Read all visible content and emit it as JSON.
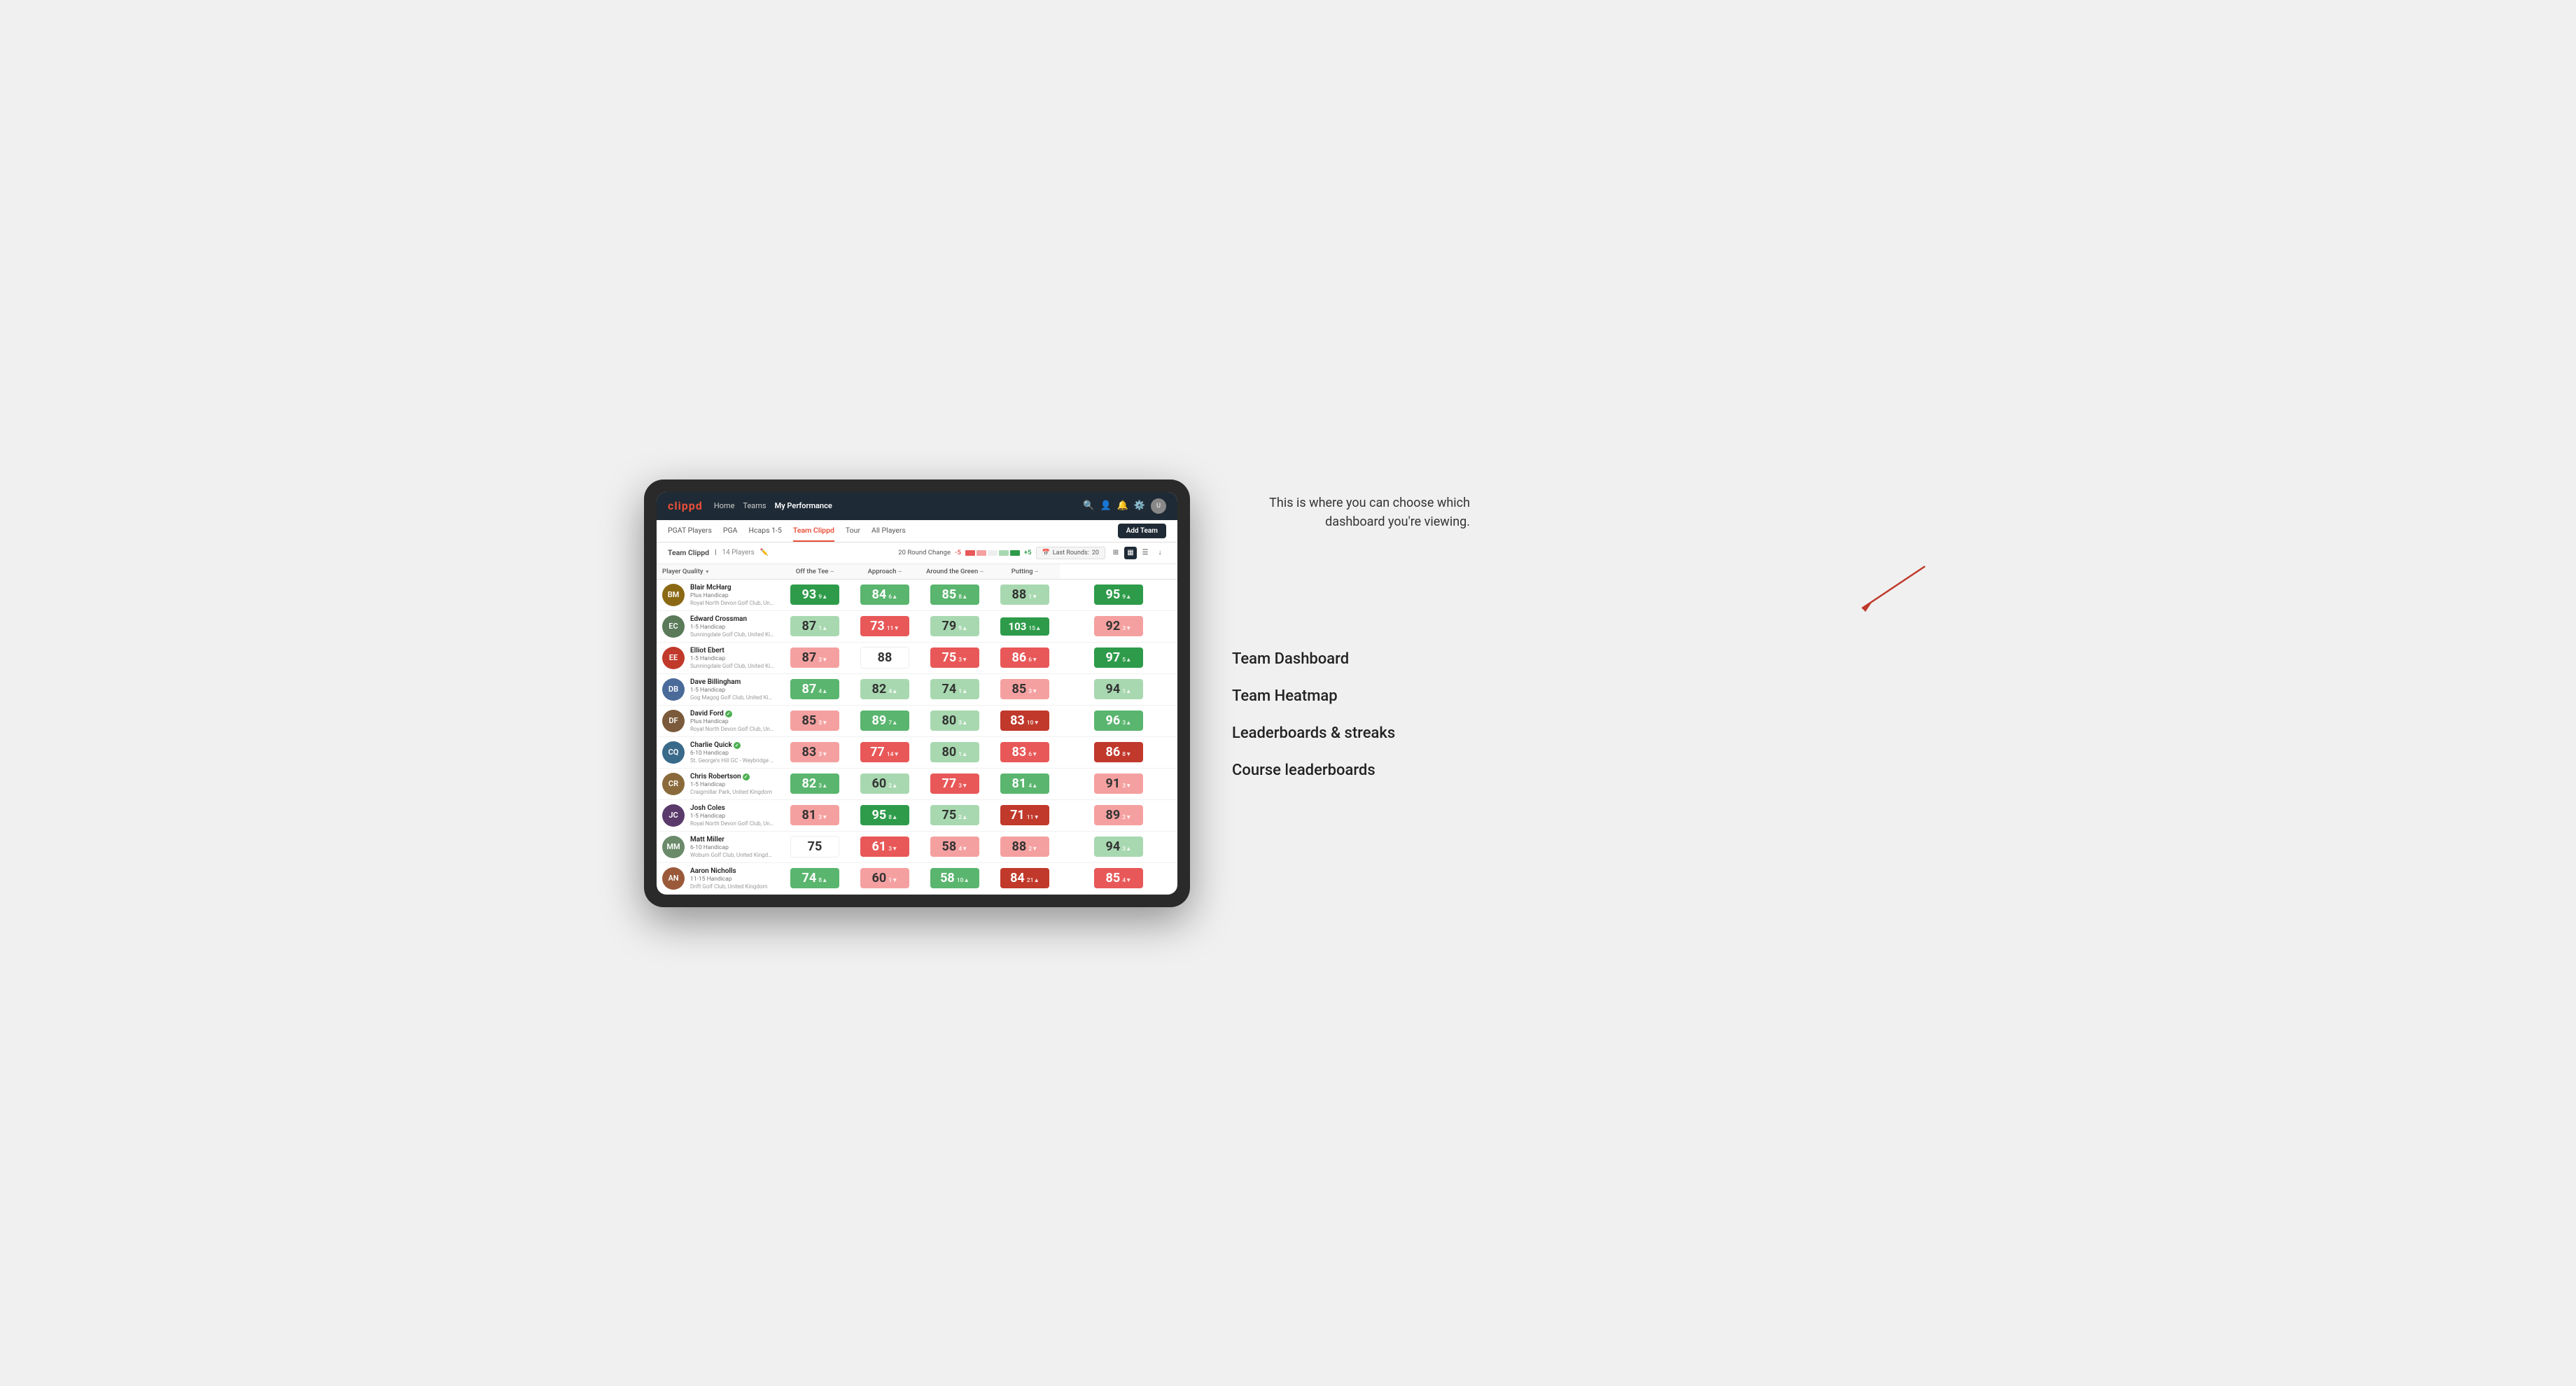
{
  "annotation": {
    "intro": "This is where you can choose which dashboard you're viewing.",
    "items": [
      "Team Dashboard",
      "Team Heatmap",
      "Leaderboards & streaks",
      "Course leaderboards"
    ]
  },
  "nav": {
    "logo": "clippd",
    "links": [
      "Home",
      "Teams",
      "My Performance"
    ],
    "active_link": "My Performance"
  },
  "sub_nav": {
    "links": [
      "PGAT Players",
      "PGA",
      "Hcaps 1-5",
      "Team Clippd",
      "Tour",
      "All Players"
    ],
    "active": "Team Clippd",
    "add_team": "Add Team"
  },
  "team_header": {
    "name": "Team Clippd",
    "separator": "|",
    "count": "14 Players",
    "round_change_label": "20 Round Change",
    "change_value": "-5",
    "change_positive": "+5",
    "last_rounds_label": "Last Rounds:",
    "last_rounds_value": "20"
  },
  "columns": {
    "player": "Player Quality",
    "off_tee": "Off the Tee",
    "approach": "Approach",
    "around_green": "Around the Green",
    "putting": "Putting"
  },
  "players": [
    {
      "name": "Blair McHarg",
      "handicap": "Plus Handicap",
      "club": "Royal North Devon Golf Club, United Kingdom",
      "avatar_color": "#8B6914",
      "initials": "BM",
      "player_quality": {
        "value": "93",
        "change": "9",
        "direction": "up",
        "bg": "bg-green-dark"
      },
      "off_tee": {
        "value": "84",
        "change": "6",
        "direction": "up",
        "bg": "bg-green-mid"
      },
      "approach": {
        "value": "85",
        "change": "8",
        "direction": "up",
        "bg": "bg-green-mid"
      },
      "around_green": {
        "value": "88",
        "change": "1",
        "direction": "down",
        "bg": "bg-green-light"
      },
      "putting": {
        "value": "95",
        "change": "9",
        "direction": "up",
        "bg": "bg-green-dark"
      }
    },
    {
      "name": "Edward Crossman",
      "handicap": "1-5 Handicap",
      "club": "Sunningdale Golf Club, United Kingdom",
      "avatar_color": "#5a7a5a",
      "initials": "EC",
      "player_quality": {
        "value": "87",
        "change": "1",
        "direction": "up",
        "bg": "bg-green-light"
      },
      "off_tee": {
        "value": "73",
        "change": "11",
        "direction": "down",
        "bg": "bg-red-mid"
      },
      "approach": {
        "value": "79",
        "change": "9",
        "direction": "up",
        "bg": "bg-green-light"
      },
      "around_green": {
        "value": "103",
        "change": "15",
        "direction": "up",
        "bg": "bg-green-dark"
      },
      "putting": {
        "value": "92",
        "change": "3",
        "direction": "down",
        "bg": "bg-red-light"
      }
    },
    {
      "name": "Elliot Ebert",
      "handicap": "1-5 Handicap",
      "club": "Sunningdale Golf Club, United Kingdom",
      "avatar_color": "#c0392b",
      "initials": "EE",
      "player_quality": {
        "value": "87",
        "change": "3",
        "direction": "down",
        "bg": "bg-red-light"
      },
      "off_tee": {
        "value": "88",
        "change": "",
        "direction": "none",
        "bg": "bg-white"
      },
      "approach": {
        "value": "75",
        "change": "3",
        "direction": "down",
        "bg": "bg-red-mid"
      },
      "around_green": {
        "value": "86",
        "change": "6",
        "direction": "down",
        "bg": "bg-red-mid"
      },
      "putting": {
        "value": "97",
        "change": "5",
        "direction": "up",
        "bg": "bg-green-dark"
      }
    },
    {
      "name": "Dave Billingham",
      "handicap": "1-5 Handicap",
      "club": "Gog Magog Golf Club, United Kingdom",
      "avatar_color": "#4a6a9a",
      "initials": "DB",
      "player_quality": {
        "value": "87",
        "change": "4",
        "direction": "up",
        "bg": "bg-green-mid"
      },
      "off_tee": {
        "value": "82",
        "change": "4",
        "direction": "up",
        "bg": "bg-green-light"
      },
      "approach": {
        "value": "74",
        "change": "1",
        "direction": "up",
        "bg": "bg-green-light"
      },
      "around_green": {
        "value": "85",
        "change": "3",
        "direction": "down",
        "bg": "bg-red-light"
      },
      "putting": {
        "value": "94",
        "change": "1",
        "direction": "up",
        "bg": "bg-green-light"
      }
    },
    {
      "name": "David Ford",
      "handicap": "Plus Handicap",
      "club": "Royal North Devon Golf Club, United Kingdom",
      "avatar_color": "#7a5a3a",
      "initials": "DF",
      "verified": true,
      "player_quality": {
        "value": "85",
        "change": "3",
        "direction": "down",
        "bg": "bg-red-light"
      },
      "off_tee": {
        "value": "89",
        "change": "7",
        "direction": "up",
        "bg": "bg-green-mid"
      },
      "approach": {
        "value": "80",
        "change": "3",
        "direction": "up",
        "bg": "bg-green-light"
      },
      "around_green": {
        "value": "83",
        "change": "10",
        "direction": "down",
        "bg": "bg-red-dark"
      },
      "putting": {
        "value": "96",
        "change": "3",
        "direction": "up",
        "bg": "bg-green-mid"
      }
    },
    {
      "name": "Charlie Quick",
      "handicap": "6-10 Handicap",
      "club": "St. George's Hill GC - Weybridge - Surrey, Uni...",
      "avatar_color": "#3a6a8a",
      "initials": "CQ",
      "verified": true,
      "player_quality": {
        "value": "83",
        "change": "3",
        "direction": "down",
        "bg": "bg-red-light"
      },
      "off_tee": {
        "value": "77",
        "change": "14",
        "direction": "down",
        "bg": "bg-red-mid"
      },
      "approach": {
        "value": "80",
        "change": "1",
        "direction": "up",
        "bg": "bg-green-light"
      },
      "around_green": {
        "value": "83",
        "change": "6",
        "direction": "down",
        "bg": "bg-red-mid"
      },
      "putting": {
        "value": "86",
        "change": "8",
        "direction": "down",
        "bg": "bg-red-dark"
      }
    },
    {
      "name": "Chris Robertson",
      "handicap": "1-5 Handicap",
      "club": "Craigmillar Park, United Kingdom",
      "avatar_color": "#8a6a3a",
      "initials": "CR",
      "verified": true,
      "player_quality": {
        "value": "82",
        "change": "3",
        "direction": "up",
        "bg": "bg-green-mid"
      },
      "off_tee": {
        "value": "60",
        "change": "2",
        "direction": "up",
        "bg": "bg-green-light"
      },
      "approach": {
        "value": "77",
        "change": "3",
        "direction": "down",
        "bg": "bg-red-mid"
      },
      "around_green": {
        "value": "81",
        "change": "4",
        "direction": "up",
        "bg": "bg-green-mid"
      },
      "putting": {
        "value": "91",
        "change": "3",
        "direction": "down",
        "bg": "bg-red-light"
      }
    },
    {
      "name": "Josh Coles",
      "handicap": "1-5 Handicap",
      "club": "Royal North Devon Golf Club, United Kingdom",
      "avatar_color": "#5a3a6a",
      "initials": "JC",
      "player_quality": {
        "value": "81",
        "change": "3",
        "direction": "down",
        "bg": "bg-red-light"
      },
      "off_tee": {
        "value": "95",
        "change": "8",
        "direction": "up",
        "bg": "bg-green-dark"
      },
      "approach": {
        "value": "75",
        "change": "2",
        "direction": "up",
        "bg": "bg-green-light"
      },
      "around_green": {
        "value": "71",
        "change": "11",
        "direction": "down",
        "bg": "bg-red-dark"
      },
      "putting": {
        "value": "89",
        "change": "2",
        "direction": "down",
        "bg": "bg-red-light"
      }
    },
    {
      "name": "Matt Miller",
      "handicap": "6-10 Handicap",
      "club": "Woburn Golf Club, United Kingdom",
      "avatar_color": "#6a8a6a",
      "initials": "MM",
      "player_quality": {
        "value": "75",
        "change": "",
        "direction": "none",
        "bg": "bg-white"
      },
      "off_tee": {
        "value": "61",
        "change": "3",
        "direction": "down",
        "bg": "bg-red-mid"
      },
      "approach": {
        "value": "58",
        "change": "4",
        "direction": "down",
        "bg": "bg-red-light"
      },
      "around_green": {
        "value": "88",
        "change": "2",
        "direction": "down",
        "bg": "bg-red-light"
      },
      "putting": {
        "value": "94",
        "change": "3",
        "direction": "up",
        "bg": "bg-green-light"
      }
    },
    {
      "name": "Aaron Nicholls",
      "handicap": "11-15 Handicap",
      "club": "Drift Golf Club, United Kingdom",
      "avatar_color": "#9a5a3a",
      "initials": "AN",
      "player_quality": {
        "value": "74",
        "change": "8",
        "direction": "up",
        "bg": "bg-green-mid"
      },
      "off_tee": {
        "value": "60",
        "change": "1",
        "direction": "down",
        "bg": "bg-red-light"
      },
      "approach": {
        "value": "58",
        "change": "10",
        "direction": "up",
        "bg": "bg-green-mid"
      },
      "around_green": {
        "value": "84",
        "change": "21",
        "direction": "up",
        "bg": "bg-red-dark"
      },
      "putting": {
        "value": "85",
        "change": "4",
        "direction": "down",
        "bg": "bg-red-mid"
      }
    }
  ]
}
